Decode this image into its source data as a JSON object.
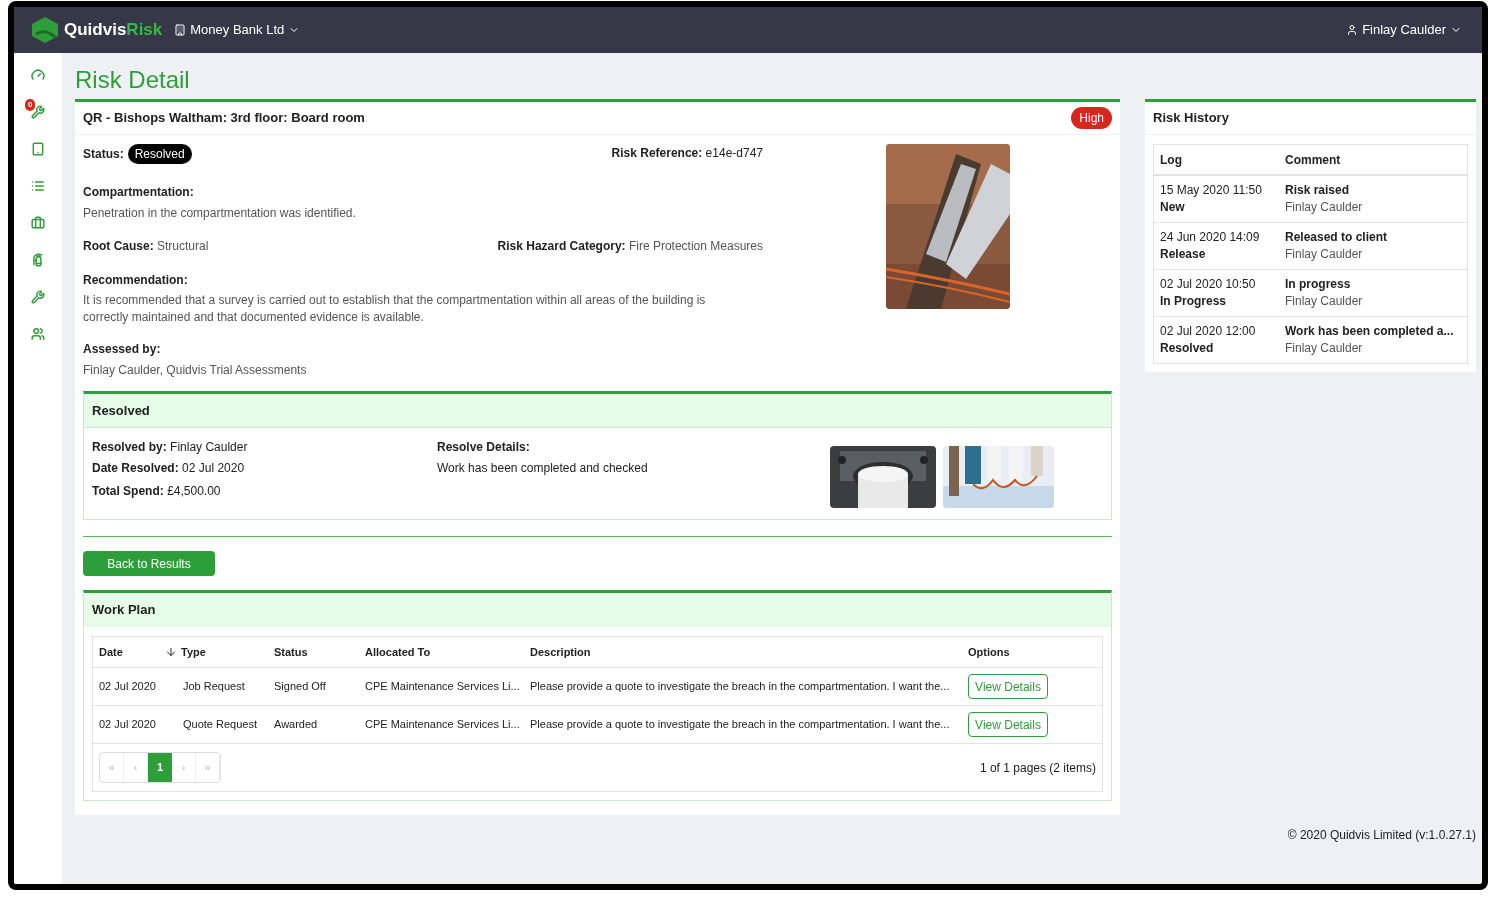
{
  "header": {
    "brand_left": "Quidvis",
    "brand_right": "Risk",
    "organisation": "Money Bank Ltd",
    "user": "Finlay Caulder"
  },
  "sidebar": {
    "items": [
      {
        "kind": "gauge"
      },
      {
        "kind": "wrench",
        "badge": "0"
      },
      {
        "kind": "tablet"
      },
      {
        "kind": "list"
      },
      {
        "kind": "briefcase"
      },
      {
        "kind": "extinguisher"
      },
      {
        "kind": "wrench"
      },
      {
        "kind": "users"
      }
    ]
  },
  "page_title": "Risk Detail",
  "risk": {
    "title": "QR - Bishops Waltham: 3rd floor: Board room",
    "priority": "High",
    "status_label": "Status:",
    "status": "Resolved",
    "reference_label": "Risk Reference:",
    "reference": "e14e-d747",
    "compartmentation_label": "Compartmentation:",
    "compartmentation": "Penetration in the compartmentation was identified.",
    "root_cause_label": "Root Cause:",
    "root_cause": "Structural",
    "category_label": "Risk Hazard Category:",
    "category": "Fire Protection Measures",
    "recommendation_label": "Recommendation:",
    "recommendation": "It is recommended that a survey is carried out to establish that the compartmentation within all areas of the building is correctly maintained and that documented evidence is available.",
    "assessed_label": "Assessed by:",
    "assessed": "Finlay Caulder, Quidvis Trial Assessments"
  },
  "resolved": {
    "title": "Resolved",
    "fields": [
      {
        "label": "Resolved by:",
        "value": "Finlay Caulder"
      },
      {
        "label": "Date Resolved:",
        "value": "02 Jul 2020"
      },
      {
        "label": "Total Spend:",
        "value": "£4,500.00"
      }
    ],
    "details_label": "Resolve Details:",
    "details": "Work has been completed and checked"
  },
  "back_button": "Back to Results",
  "work_plan": {
    "title": "Work Plan",
    "columns": [
      "Date",
      "Type",
      "Status",
      "Allocated To",
      "Description",
      "Options"
    ],
    "rows": [
      [
        "02 Jul 2020",
        "Job Request",
        "Signed Off",
        "CPE Maintenance Services Li...",
        "Please provide a quote to investigate the breach in the compartmentation. I want the...",
        "View Details"
      ],
      [
        "02 Jul 2020",
        "Quote Request",
        "Awarded",
        "CPE Maintenance Services Li...",
        "Please provide a quote to investigate the breach in the compartmentation. I want the...",
        "View Details"
      ]
    ],
    "pages": [
      {
        "label": "«",
        "selected": false
      },
      {
        "label": "‹",
        "selected": false
      },
      {
        "label": "1",
        "selected": true
      },
      {
        "label": "›",
        "selected": false
      },
      {
        "label": "»",
        "selected": false
      }
    ],
    "page_info": "1 of 1 pages (2 items)"
  },
  "history": {
    "title": "Risk History",
    "columns": [
      "Log",
      "Comment"
    ],
    "rows": [
      {
        "time": "15 May 2020 11:50",
        "state": "New",
        "comment": "Risk raised",
        "by": "Finlay Caulder"
      },
      {
        "time": "24 Jun 2020 14:09",
        "state": "Release",
        "comment": "Released to client",
        "by": "Finlay Caulder"
      },
      {
        "time": "02 Jul 2020 10:50",
        "state": "In Progress",
        "comment": "In progress",
        "by": "Finlay Caulder"
      },
      {
        "time": "02 Jul 2020 12:00",
        "state": "Resolved",
        "comment": "Work has been completed a...",
        "by": "Finlay Caulder"
      }
    ]
  },
  "footer": "© 2020 Quidvis Limited (v:1.0.27.1)"
}
